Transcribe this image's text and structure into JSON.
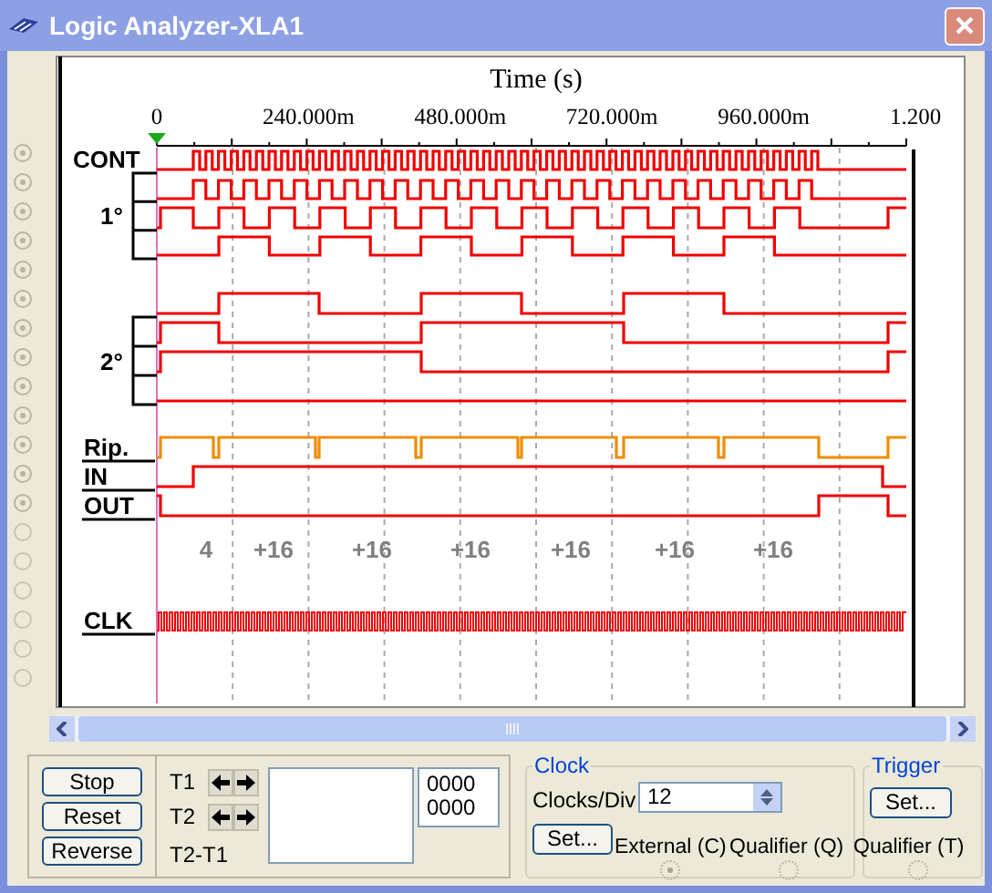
{
  "window": {
    "title": "Logic Analyzer-XLA1"
  },
  "plot": {
    "axis_title": "Time (s)",
    "ticks": [
      "0",
      "240.000m",
      "480.000m",
      "720.000m",
      "960.000m",
      "1.200"
    ],
    "channels": [
      {
        "label": "CONT",
        "kind": "plain"
      },
      {
        "label": "1°",
        "kind": "group"
      },
      {
        "label": "2°",
        "kind": "group"
      },
      {
        "label": "Rip.",
        "kind": "underlined"
      },
      {
        "label": "IN",
        "kind": "underlined"
      },
      {
        "label": "OUT",
        "kind": "underlined"
      },
      {
        "label": "CLK",
        "kind": "underlined"
      }
    ],
    "counts": [
      "4",
      "+16",
      "+16",
      "+16",
      "+16",
      "+16",
      "+16"
    ]
  },
  "controls": {
    "buttons": [
      "Stop",
      "Reset",
      "Reverse"
    ],
    "cursors": [
      {
        "label": "T1",
        "value": "0000"
      },
      {
        "label": "T2",
        "value": "0000"
      }
    ],
    "difference_label": "T2-T1",
    "clock": {
      "title": "Clock",
      "clocks_per_div_label": "Clocks/Div",
      "clocks_per_div": "12",
      "set_button": "Set...",
      "external_label": "External (C)",
      "external_selected": true,
      "qualifier_label": "Qualifier (Q)",
      "qualifier_selected": false
    },
    "trigger": {
      "title": "Trigger",
      "set_button": "Set...",
      "qualifier_label": "Qualifier (T)",
      "qualifier_selected": false
    }
  }
}
